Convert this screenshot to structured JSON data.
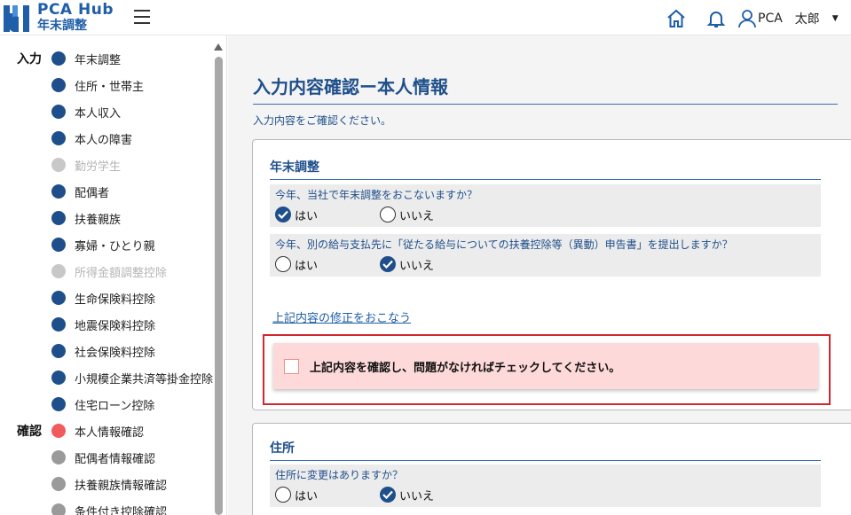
{
  "header": {
    "brand_name": "PCA Hub",
    "brand_sub": "年末調整",
    "user_name": "PCA",
    "user_name2": "太郎"
  },
  "sidebar": {
    "steps": [
      {
        "group": "入力",
        "label": "年末調整",
        "state": "done",
        "color": "#1f4f8b"
      },
      {
        "group": "",
        "label": "住所・世帯主",
        "state": "done",
        "color": "#1f4f8b"
      },
      {
        "group": "",
        "label": "本人収入",
        "state": "done",
        "color": "#1f4f8b"
      },
      {
        "group": "",
        "label": "本人の障害",
        "state": "done",
        "color": "#1f4f8b"
      },
      {
        "group": "",
        "label": "勤労学生",
        "state": "disabled",
        "color": "#c8c8c8"
      },
      {
        "group": "",
        "label": "配偶者",
        "state": "done",
        "color": "#1f4f8b"
      },
      {
        "group": "",
        "label": "扶養親族",
        "state": "done",
        "color": "#1f4f8b"
      },
      {
        "group": "",
        "label": "寡婦・ひとり親",
        "state": "done",
        "color": "#1f4f8b"
      },
      {
        "group": "",
        "label": "所得金額調整控除",
        "state": "disabled",
        "color": "#c8c8c8"
      },
      {
        "group": "",
        "label": "生命保険料控除",
        "state": "done",
        "color": "#1f4f8b"
      },
      {
        "group": "",
        "label": "地震保険料控除",
        "state": "done",
        "color": "#1f4f8b"
      },
      {
        "group": "",
        "label": "社会保険料控除",
        "state": "done",
        "color": "#1f4f8b"
      },
      {
        "group": "",
        "label": "小規模企業共済等掛金控除",
        "state": "done",
        "color": "#1f4f8b"
      },
      {
        "group": "",
        "label": "住宅ローン控除",
        "state": "done",
        "color": "#1f4f8b"
      },
      {
        "group": "確認",
        "label": "本人情報確認",
        "state": "current",
        "color": "#f25b5b"
      },
      {
        "group": "",
        "label": "配偶者情報確認",
        "state": "pending",
        "color": "#9a9a9a"
      },
      {
        "group": "",
        "label": "扶養親族情報確認",
        "state": "pending",
        "color": "#9a9a9a"
      },
      {
        "group": "",
        "label": "条件付き控除確認",
        "state": "pending",
        "color": "#9a9a9a"
      }
    ]
  },
  "main": {
    "title": "入力内容確認ー本人情報",
    "intro": "入力内容をご確認ください。",
    "section1": {
      "title": "年末調整",
      "q1": {
        "text": "今年、当社で年末調整をおこないますか？",
        "opt_yes": "はい",
        "opt_no": "いいえ",
        "selected": "yes"
      },
      "q2": {
        "text": "今年、別の給与支払先に「従たる給与についての扶養控除等（異動）申告書」を提出しますか？",
        "opt_yes": "はい",
        "opt_no": "いいえ",
        "selected": "no"
      },
      "modify_link": "上記内容の修正をおこなう",
      "confirm_text": "上記内容を確認し、問題がなければチェックしてください。"
    },
    "section2": {
      "title": "住所",
      "q1": {
        "text": "住所に変更はありますか？",
        "opt_yes": "はい",
        "opt_no": "いいえ",
        "selected": "no"
      }
    }
  },
  "colors": {
    "accent": "#1f4f8b",
    "brand": "#1f5ea8",
    "alert": "#d2272f",
    "alert_bg": "#fdd9d9"
  }
}
